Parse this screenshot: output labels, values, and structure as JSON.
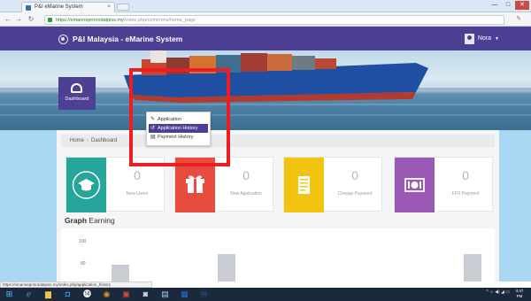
{
  "browser": {
    "tab_title": "P&I eMarine System",
    "tab_close": "×",
    "address_host": "https://emarineprinrodatpiss.my",
    "address_path": "/index.php/commons/home_page",
    "window_buttons": [
      "—",
      "□",
      "✕"
    ]
  },
  "header": {
    "brand": "P&I Malaysia - eMarine System",
    "user_name": "Nora"
  },
  "sidebar": {
    "dashboard_label": "Dashboard"
  },
  "dropdown": {
    "items": [
      {
        "label": "Application",
        "icon": "pencil-icon",
        "active": false
      },
      {
        "label": "Application History",
        "icon": "history-icon",
        "active": true
      },
      {
        "label": "Payment History",
        "icon": "receipt-icon",
        "active": false
      }
    ]
  },
  "breadcrumb": {
    "home": "Home",
    "current": "Dashboard"
  },
  "cards": [
    {
      "count": "0",
      "label": "New Users",
      "color": "#26a69a",
      "icon": "graduation-cap-icon"
    },
    {
      "count": "0",
      "label": "New Application",
      "color": "#e74c3c",
      "icon": "gift-icon"
    },
    {
      "count": "0",
      "label": "Cheque Payment",
      "color": "#f1c40f",
      "icon": "document-icon"
    },
    {
      "count": "0",
      "label": "FPX Payment",
      "color": "#9b59b6",
      "icon": "money-icon"
    }
  ],
  "graph": {
    "title_bold": "Graph",
    "title_rest": "Earning"
  },
  "chart_data": {
    "type": "bar",
    "yticks": [
      "100",
      "80"
    ]
  },
  "status_url": "https://emarineprinrodatpiss.my/index.php/application_history",
  "taskbar": {
    "tray_text": "^ ☼ ◀) ◢ ▭",
    "clock_time": "4:47",
    "clock_date": "PM"
  },
  "colors": {
    "brand": "#4d3f94",
    "highlight": "#ee1d24",
    "page_bg": "#a9d6f0"
  }
}
